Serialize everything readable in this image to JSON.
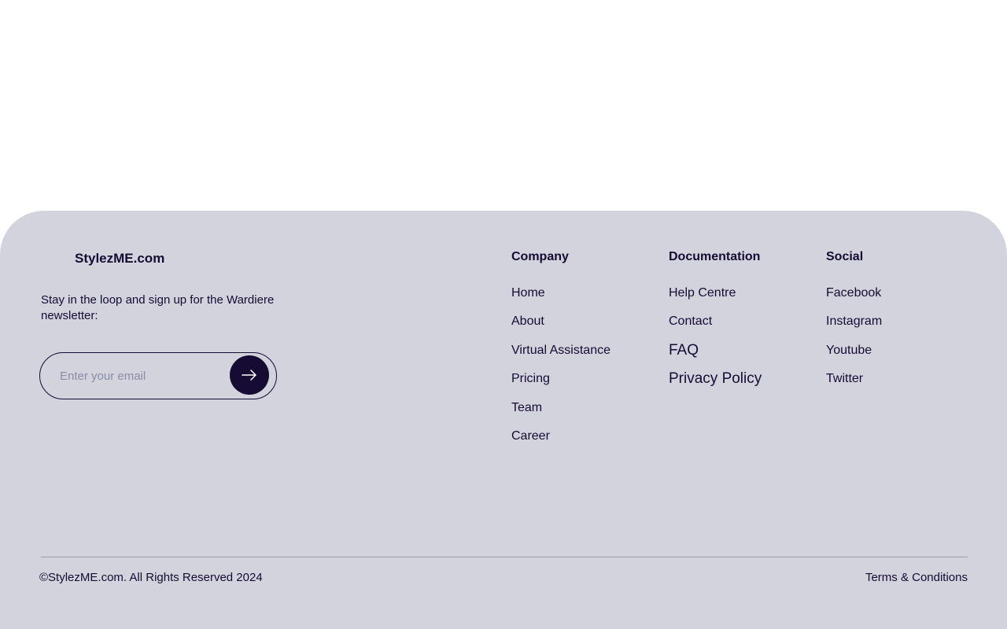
{
  "footer": {
    "brand": "StylezME.com",
    "tagline": "Stay in the loop and sign up for the Wardiere newsletter:",
    "email_placeholder": "Enter your email",
    "columns": [
      {
        "title": "Company",
        "links": [
          "Home",
          "About",
          "Virtual Assistance",
          "Pricing",
          "Team",
          "Career"
        ]
      },
      {
        "title": "Documentation",
        "links": [
          "Help Centre",
          "Contact",
          "FAQ",
          "Privacy Policy"
        ]
      },
      {
        "title": "Social",
        "links": [
          "Facebook",
          "Instagram",
          "Youtube",
          "Twitter"
        ]
      }
    ],
    "copyright": "©StylezME.com. All Rights Reserved 2024",
    "terms": "Terms & Conditions"
  },
  "colors": {
    "footer_bg": "#d2d3dd",
    "text": "#160b33",
    "button_bg": "#160b33"
  },
  "icons": {
    "submit": "arrow-right-icon"
  }
}
